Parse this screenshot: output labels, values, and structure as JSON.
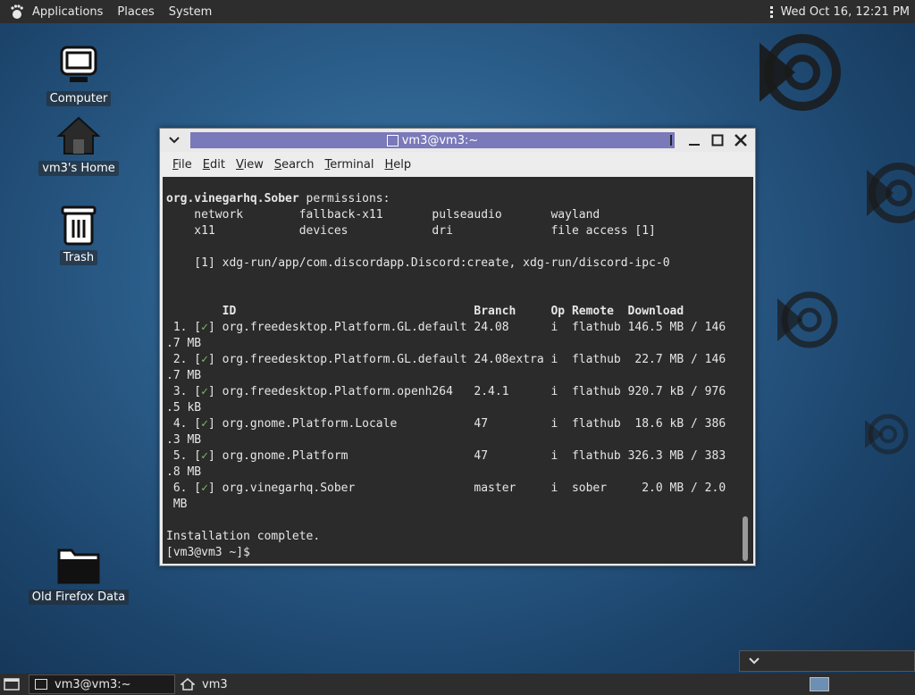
{
  "top_panel": {
    "menus": [
      "Applications",
      "Places",
      "System"
    ],
    "clock": "Wed Oct 16, 12:21 PM",
    "gnome_icon": "gnome-foot-icon",
    "tray_icon": "vertical-dots-icon"
  },
  "desktop": {
    "icons": [
      {
        "label": "Computer",
        "icon": "computer-icon"
      },
      {
        "label": "vm3's Home",
        "icon": "home-icon"
      },
      {
        "label": "Trash",
        "icon": "trash-icon"
      },
      {
        "label": "Old Firefox Data",
        "icon": "folder-icon"
      }
    ]
  },
  "window": {
    "title": "vm3@vm3:~",
    "menubar": [
      {
        "label": "File",
        "mnemonic": "F",
        "rest": "ile"
      },
      {
        "label": "Edit",
        "mnemonic": "E",
        "rest": "dit"
      },
      {
        "label": "View",
        "mnemonic": "V",
        "rest": "iew"
      },
      {
        "label": "Search",
        "mnemonic": "S",
        "rest": "earch"
      },
      {
        "label": "Terminal",
        "mnemonic": "T",
        "rest": "erminal"
      },
      {
        "label": "Help",
        "mnemonic": "H",
        "rest": "elp"
      }
    ],
    "terminal": {
      "app_name": "org.vinegarhq.Sober",
      "permissions_label": " permissions:",
      "perm_line_1": "    network        fallback-x11       pulseaudio       wayland",
      "perm_line_2": "    x11            devices            dri              file access [1]",
      "note_line": "    [1] xdg-run/app/com.discordapp.Discord:create, xdg-run/discord-ipc-0",
      "table_header": "        ID                                  Branch     Op Remote  Download",
      "rows": [
        {
          "num": " 1. [",
          "name": "] org.freedesktop.Platform.GL.default 24.08      i  flathub 146.5 MB / 146",
          "cont": ".7 MB"
        },
        {
          "num": " 2. [",
          "name": "] org.freedesktop.Platform.GL.default 24.08extra i  flathub  22.7 MB / 146",
          "cont": ".7 MB"
        },
        {
          "num": " 3. [",
          "name": "] org.freedesktop.Platform.openh264   2.4.1      i  flathub 920.7 kB / 976",
          "cont": ".5 kB"
        },
        {
          "num": " 4. [",
          "name": "] org.gnome.Platform.Locale           47         i  flathub  18.6 kB / 386",
          "cont": ".3 MB"
        },
        {
          "num": " 5. [",
          "name": "] org.gnome.Platform                  47         i  flathub 326.3 MB / 383",
          "cont": ".8 MB"
        },
        {
          "num": " 6. [",
          "name": "] org.vinegarhq.Sober                 master     i  sober     2.0 MB / 2.0",
          "cont": " MB"
        }
      ],
      "checkmark": "✓",
      "status": "Installation complete.",
      "prompt": "[vm3@vm3 ~]$ "
    }
  },
  "bottom_panel": {
    "tasks": [
      {
        "label": "vm3@vm3:~",
        "active": true
      },
      {
        "label": "vm3",
        "active": false
      }
    ]
  },
  "colors": {
    "panel": "#2d2d2d",
    "title_accent": "#7a79b9",
    "terminal_bg": "#2b2b2b",
    "check_green": "#7fbf5f"
  }
}
